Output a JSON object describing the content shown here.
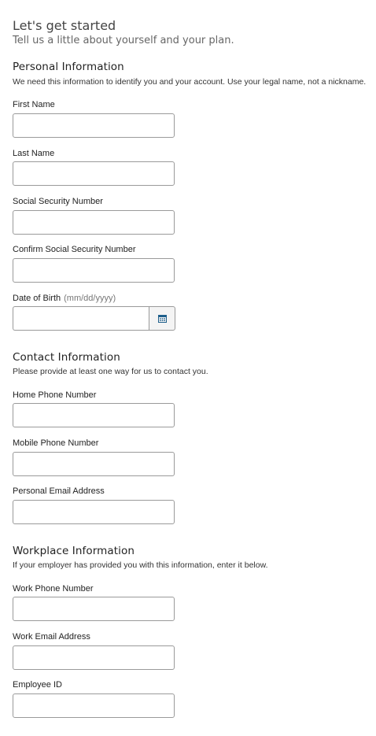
{
  "header": {
    "title": "Let's get started",
    "subtitle": "Tell us a little about yourself and your plan."
  },
  "personal": {
    "title": "Personal Information",
    "description": "We need this information to identify you and your account. Use your legal name, not a nickname.",
    "first_name": {
      "label": "First Name",
      "value": ""
    },
    "last_name": {
      "label": "Last Name",
      "value": ""
    },
    "ssn": {
      "label": "Social Security Number",
      "value": ""
    },
    "confirm_ssn": {
      "label": "Confirm Social Security Number",
      "value": ""
    },
    "dob": {
      "label": "Date of Birth",
      "hint": "(mm/dd/yyyy)",
      "value": ""
    }
  },
  "contact": {
    "title": "Contact Information",
    "description": "Please provide at least one way for us to contact you.",
    "home_phone": {
      "label": "Home Phone Number",
      "value": ""
    },
    "mobile_phone": {
      "label": "Mobile Phone Number",
      "value": ""
    },
    "personal_email": {
      "label": "Personal Email Address",
      "value": ""
    }
  },
  "workplace": {
    "title": "Workplace Information",
    "description": "If your employer has provided you with this information, enter it below.",
    "work_phone": {
      "label": "Work Phone Number",
      "value": ""
    },
    "work_email": {
      "label": "Work Email Address",
      "value": ""
    },
    "employee_id": {
      "label": "Employee ID",
      "value": ""
    }
  },
  "icons": {
    "calendar": "calendar-icon"
  },
  "colors": {
    "calendar_icon": "#1f5f8b",
    "input_border": "#9a9a9a"
  }
}
